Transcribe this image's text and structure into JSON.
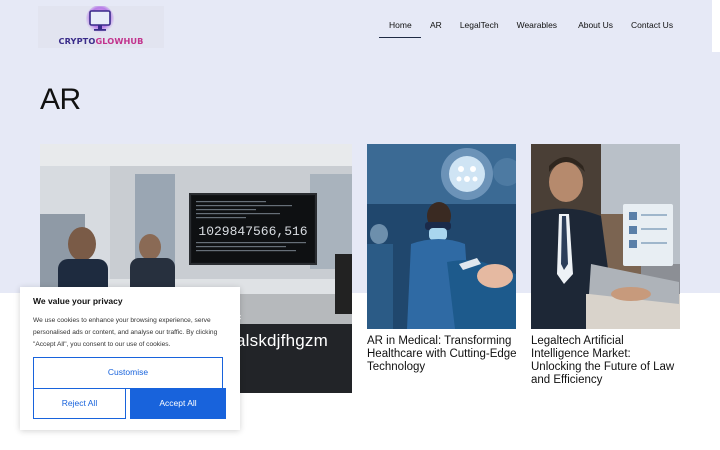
{
  "brand": {
    "part1": "CRYPTO",
    "part2": "GLOWHUB"
  },
  "nav": [
    {
      "label": "Home",
      "active": true
    },
    {
      "label": "AR",
      "active": false
    },
    {
      "label": "LegalTech",
      "active": false
    },
    {
      "label": "Wearables",
      "active": false
    },
    {
      "label": "About Us",
      "active": false
    },
    {
      "label": "Contact Us",
      "active": false
    }
  ],
  "page_title": "AR",
  "posts": [
    {
      "title_fragment": "f",
      "title": "alskdjfhgzm",
      "image_text": "1029847566,516",
      "image_icon": "meeting-room-photo"
    },
    {
      "title": "AR in Medical: Transforming Healthcare with Cutting-Edge Technology",
      "image_icon": "surgery-photo"
    },
    {
      "title": "Legaltech Artificial Intelligence Market: Unlocking the Future of Law and Efficiency",
      "image_icon": "lawyer-laptop-photo"
    }
  ],
  "cookie": {
    "title": "We value your privacy",
    "body": "We use cookies to enhance your browsing experience, serve personalised ads or content, and analyse our traffic. By clicking \"Accept All\", you consent to our use of cookies.",
    "customise": "Customise",
    "reject": "Reject All",
    "accept": "Accept All"
  },
  "colors": {
    "hero_bg": "#e6e9f6",
    "accent": "#1863dc",
    "brand_dark": "#3a2c8a",
    "brand_pink": "#c2338d"
  }
}
